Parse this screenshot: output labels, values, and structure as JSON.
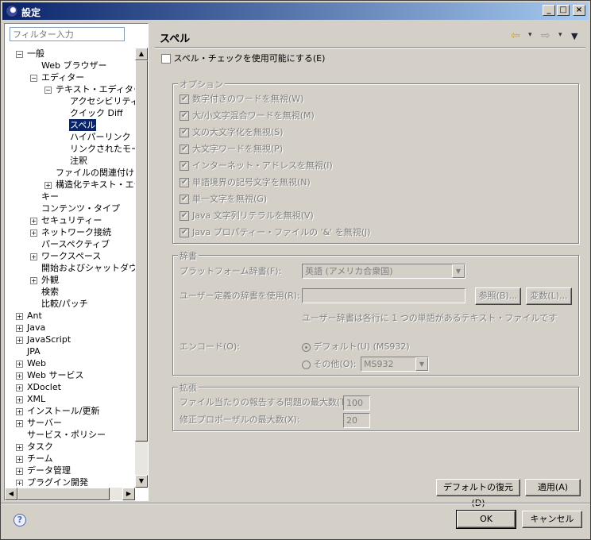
{
  "window": {
    "title": "設定",
    "min": "_",
    "max": "□",
    "close": "×"
  },
  "filter": {
    "placeholder": "フィルター入力"
  },
  "tree": [
    {
      "label": "一般",
      "level": 0,
      "exp": "−"
    },
    {
      "label": "Web ブラウザー",
      "level": 1,
      "exp": ""
    },
    {
      "label": "エディター",
      "level": 1,
      "exp": "−"
    },
    {
      "label": "テキスト・エディター",
      "level": 2,
      "exp": "−"
    },
    {
      "label": "アクセシビリティ",
      "level": 3,
      "exp": ""
    },
    {
      "label": "クイック Diff",
      "level": 3,
      "exp": ""
    },
    {
      "label": "スペル",
      "level": 3,
      "exp": "",
      "selected": true
    },
    {
      "label": "ハイパーリンク",
      "level": 3,
      "exp": ""
    },
    {
      "label": "リンクされたモード",
      "level": 3,
      "exp": ""
    },
    {
      "label": "注釈",
      "level": 3,
      "exp": ""
    },
    {
      "label": "ファイルの関連付け",
      "level": 2,
      "exp": ""
    },
    {
      "label": "構造化テキスト・エディター",
      "level": 2,
      "exp": "+"
    },
    {
      "label": "キー",
      "level": 1,
      "exp": ""
    },
    {
      "label": "コンテンツ・タイプ",
      "level": 1,
      "exp": ""
    },
    {
      "label": "セキュリティー",
      "level": 1,
      "exp": "+"
    },
    {
      "label": "ネットワーク接続",
      "level": 1,
      "exp": "+"
    },
    {
      "label": "パースペクティブ",
      "level": 1,
      "exp": ""
    },
    {
      "label": "ワークスペース",
      "level": 1,
      "exp": "+"
    },
    {
      "label": "開始およびシャットダウン",
      "level": 1,
      "exp": ""
    },
    {
      "label": "外観",
      "level": 1,
      "exp": "+"
    },
    {
      "label": "検索",
      "level": 1,
      "exp": ""
    },
    {
      "label": "比較/パッチ",
      "level": 1,
      "exp": ""
    },
    {
      "label": "Ant",
      "level": 0,
      "exp": "+"
    },
    {
      "label": "Java",
      "level": 0,
      "exp": "+"
    },
    {
      "label": "JavaScript",
      "level": 0,
      "exp": "+"
    },
    {
      "label": "JPA",
      "level": 0,
      "exp": ""
    },
    {
      "label": "Web",
      "level": 0,
      "exp": "+"
    },
    {
      "label": "Web サービス",
      "level": 0,
      "exp": "+"
    },
    {
      "label": "XDoclet",
      "level": 0,
      "exp": "+"
    },
    {
      "label": "XML",
      "level": 0,
      "exp": "+"
    },
    {
      "label": "インストール/更新",
      "level": 0,
      "exp": "+"
    },
    {
      "label": "サーバー",
      "level": 0,
      "exp": "+"
    },
    {
      "label": "サービス・ポリシー",
      "level": 0,
      "exp": ""
    },
    {
      "label": "タスク",
      "level": 0,
      "exp": "+"
    },
    {
      "label": "チーム",
      "level": 0,
      "exp": "+"
    },
    {
      "label": "データ管理",
      "level": 0,
      "exp": "+"
    },
    {
      "label": "プラグイン開発",
      "level": 0,
      "exp": "+"
    }
  ],
  "page": {
    "title": "スペル",
    "enable_spell_check": "スペル・チェックを使用可能にする(E)",
    "options": {
      "title": "オプション",
      "items": [
        "数字付きのワードを無視(W)",
        "大/小文字混合ワードを無視(M)",
        "文の大文字化を無視(S)",
        "大文字ワードを無視(P)",
        "インターネット・アドレスを無視(I)",
        "単語境界の記号文字を無視(N)",
        "単一文字を無視(G)",
        "Java 文字列リテラルを無視(V)",
        "Java プロパティー・ファイルの '&' を無視(J)"
      ]
    },
    "dictionary": {
      "title": "辞書",
      "platform_label": "プラットフォーム辞書(F):",
      "platform_value": "英語 (アメリカ合衆国)",
      "user_label": "ユーザー定義の辞書を使用(R):",
      "user_value": "",
      "browse": "参照(B)...",
      "variables": "変数(L)...",
      "note": "ユーザー辞書は各行に 1 つの単語があるテキスト・ファイルです",
      "encoding_label": "エンコード(O):",
      "default_radio": "デフォルト(U) (MS932)",
      "other_radio": "その他(O):",
      "other_value": "MS932"
    },
    "advanced": {
      "title": "拡張",
      "max_problems_label": "ファイル当たりの報告する問題の最大数(T):",
      "max_problems_value": "100",
      "max_proposals_label": "修正プロポーザルの最大数(X):",
      "max_proposals_value": "20"
    },
    "restore_defaults": "デフォルトの復元(D)",
    "apply": "適用(A)"
  },
  "footer": {
    "help": "?",
    "ok": "OK",
    "cancel": "キャンセル"
  }
}
